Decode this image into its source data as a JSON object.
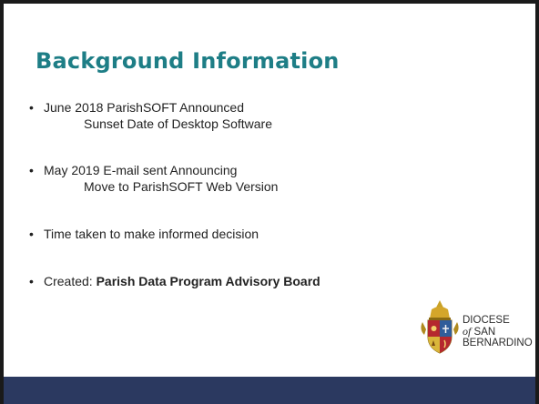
{
  "slide": {
    "title": "Background Information",
    "bullet_symbol": "•",
    "bullets": [
      {
        "line1": "June 2018 ParishSOFT Announced",
        "line2": "Sunset Date of Desktop Software"
      },
      {
        "line1": "May 2019 E-mail sent Announcing",
        "line2": "Move to ParishSOFT Web Version"
      },
      {
        "line1": "Time taken to make informed decision"
      },
      {
        "prefix": "Created: ",
        "bold": "Parish Data Program Advisory Board"
      }
    ]
  },
  "logo": {
    "line1": "DIOCESE",
    "of": "of",
    "line2": "SAN",
    "line3": "BERNARDINO",
    "icon": "diocese-crest-icon"
  },
  "colors": {
    "title": "#1e7e86",
    "text": "#222222",
    "footer": "#2b3960",
    "border": "#1a1a1a"
  }
}
